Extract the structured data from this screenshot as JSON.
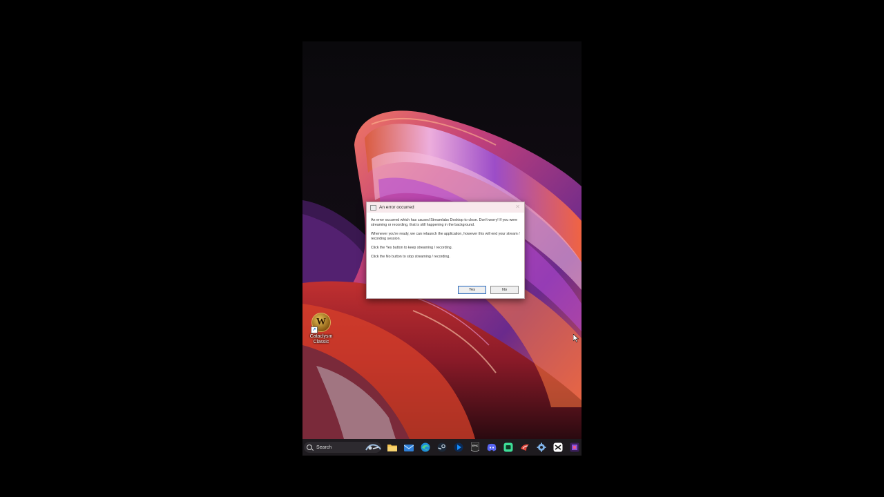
{
  "desktop": {
    "icons": [
      {
        "label_line1": "Cataclysm",
        "label_line2": "Classic",
        "glyph": "W",
        "icon": "world-of-warcraft-icon"
      }
    ]
  },
  "dialog": {
    "title": "An error occurred",
    "close_glyph": "✕",
    "paragraphs": [
      "An error occurred which has caused Streamlabs Desktop to close. Don't worry! If you were streaming or recording, that is still happening in the background.",
      "Whenever you're ready, we can relaunch the application, however this will end your stream / recording session.",
      "Click the Yes button to keep streaming / recording.",
      "Click the No button to stop streaming / recording."
    ],
    "yes_label": "Yes",
    "no_label": "No"
  },
  "taskbar": {
    "search_placeholder": "Search",
    "search_icon": "search-icon",
    "apps": [
      {
        "name": "file-explorer-icon",
        "color": "#f2c14e"
      },
      {
        "name": "mail-icon",
        "color": "#3b8ee8"
      },
      {
        "name": "edge-icon",
        "color": "#2bb6a8"
      },
      {
        "name": "steam-icon",
        "color": "#c7d5e0"
      },
      {
        "name": "battlenet-icon",
        "color": "#148eff"
      },
      {
        "name": "epic-games-icon",
        "color": "#e6e6e6"
      },
      {
        "name": "discord-icon",
        "color": "#5865f2"
      },
      {
        "name": "app-green-icon",
        "color": "#3ddc97"
      },
      {
        "name": "app-red-icon",
        "color": "#e0453a"
      },
      {
        "name": "app-gear-icon",
        "color": "#7fb3e8"
      },
      {
        "name": "capcut-icon",
        "color": "#ffffff"
      },
      {
        "name": "streamlabs-icon",
        "color": "#8a4fd8"
      }
    ],
    "epic_label": "EPIC"
  }
}
